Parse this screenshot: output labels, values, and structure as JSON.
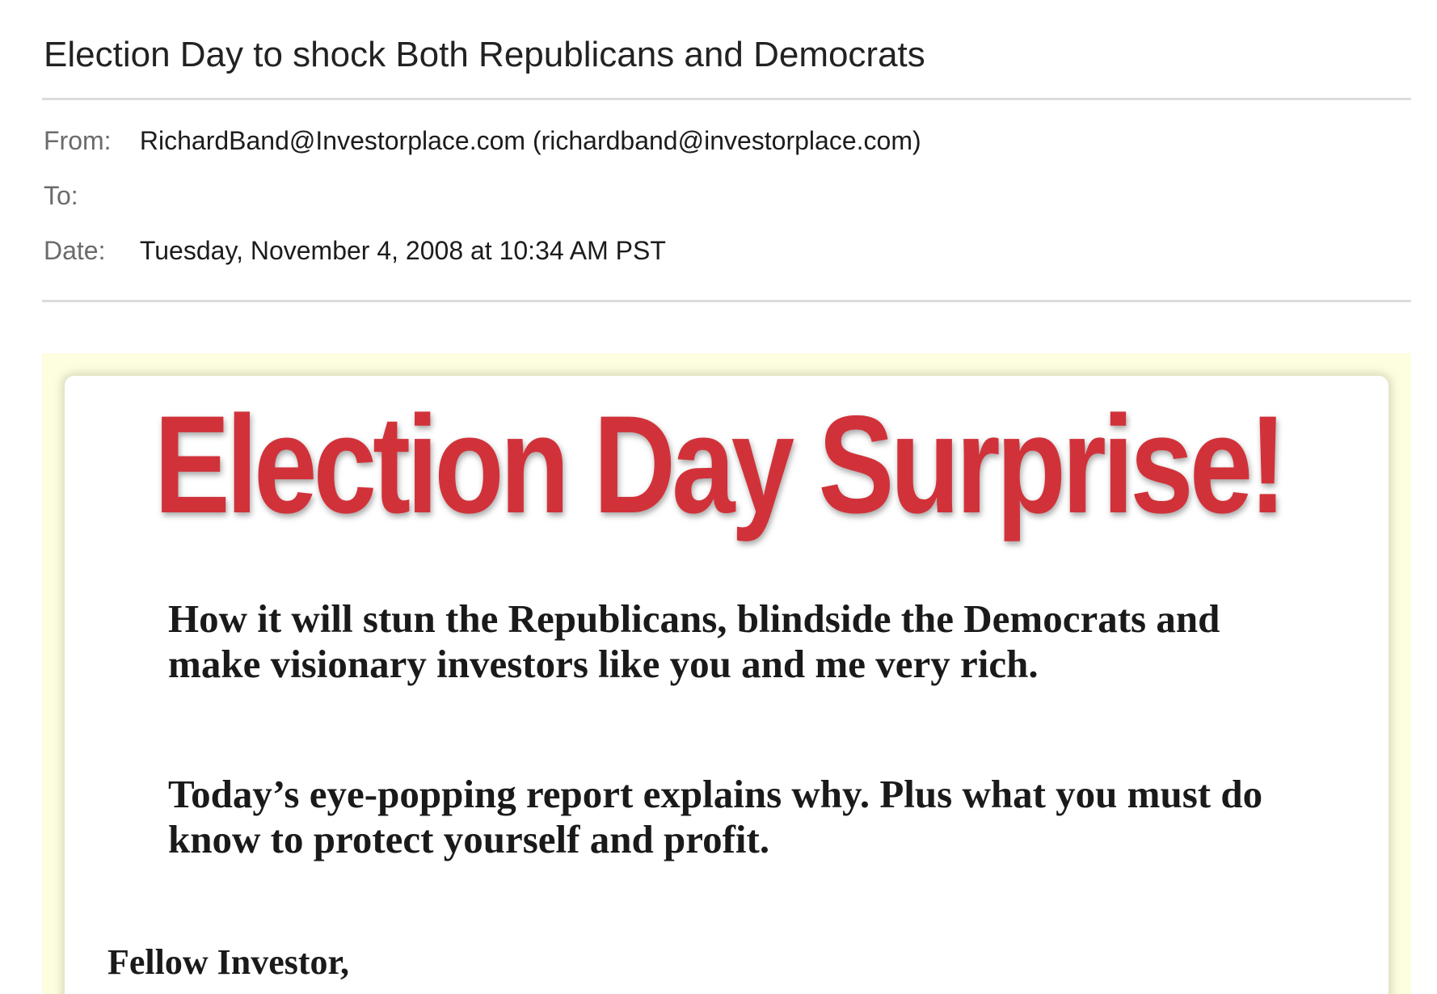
{
  "email": {
    "subject": "Election Day to shock Both Republicans and Democrats",
    "from_label": "From:",
    "from_value": "RichardBand@Investorplace.com (richardband@investorplace.com)",
    "to_label": "To:",
    "to_value": "",
    "date_label": "Date:",
    "date_value": "Tuesday, November 4, 2008 at 10:34 AM PST"
  },
  "body": {
    "headline": "Election Day Surprise!",
    "subhead_1": "How it will stun the Republicans, blindside the Democrats and make visionary investors like you and me very rich.",
    "subhead_2": "Today’s eye-popping report explains why. Plus what you must do know to protect yourself and profit.",
    "greeting": "Fellow Investor,"
  },
  "colors": {
    "headline": "#d1323a",
    "body_background": "#fdfde0",
    "card": "#ffffff",
    "label": "#6b6b6b"
  }
}
